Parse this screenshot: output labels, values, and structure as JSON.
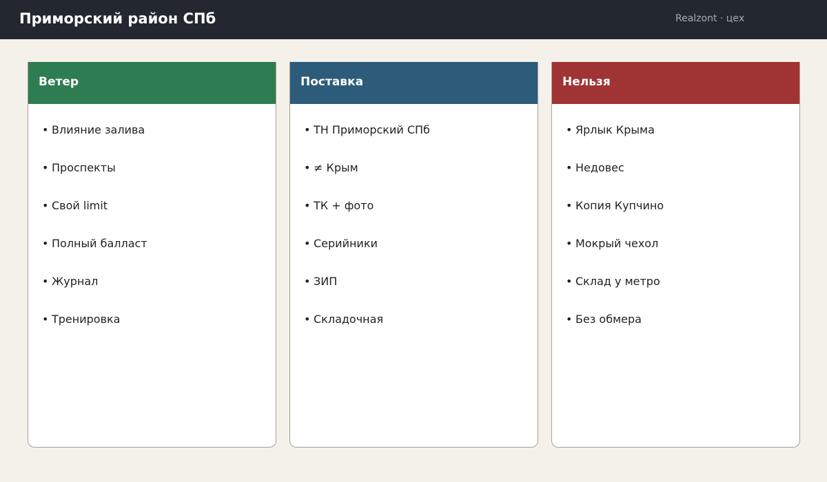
{
  "header": {
    "title": "Приморский район СПб",
    "brand": "Realzont · цех",
    "background": "#23272f"
  },
  "cards": [
    {
      "title": "Ветер",
      "color": "#2e7d52",
      "items": [
        "Влияние залива",
        "Проспекты",
        "Свой limit",
        "Полный балласт",
        "Журнал",
        "Тренировка"
      ]
    },
    {
      "title": "Поставка",
      "color": "#2d5b7a",
      "items": [
        "ТН Приморский СПб",
        "≠ Крым",
        "ТК + фото",
        "Серийники",
        "ЗИП",
        "Складочная"
      ]
    },
    {
      "title": "Нельзя",
      "color": "#a03333",
      "items": [
        "Ярлык Крыма",
        "Недовес",
        "Копия Купчино",
        "Мокрый чехол",
        "Склад у метро",
        "Без обмера"
      ]
    }
  ]
}
